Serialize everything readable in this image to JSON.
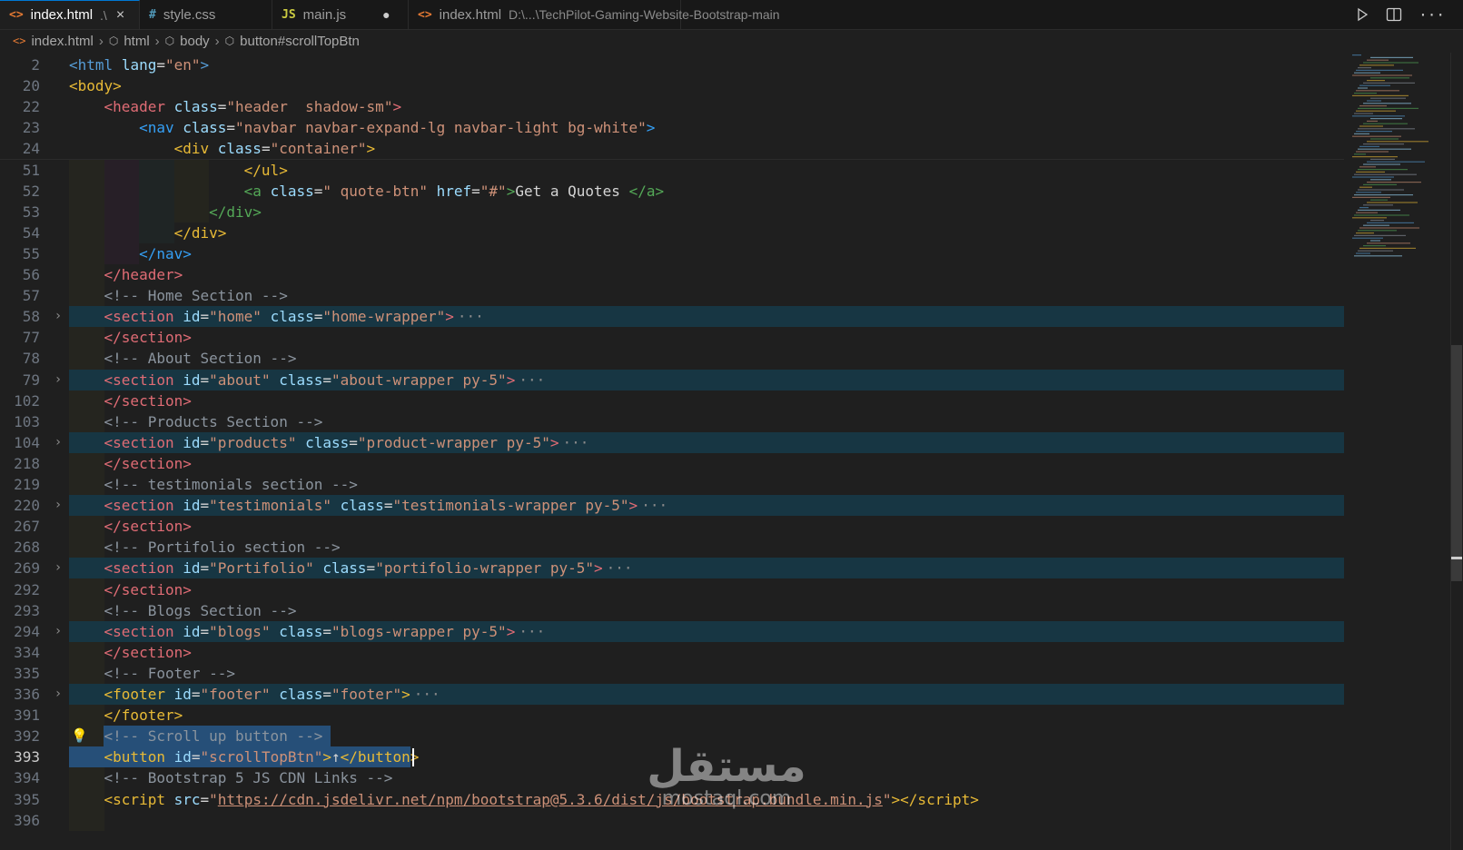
{
  "tabs": [
    {
      "label": "index.html",
      "desc": ".\\",
      "type": "html",
      "active": true,
      "close": "×"
    },
    {
      "label": "style.css",
      "desc": "",
      "type": "css",
      "active": false
    },
    {
      "label": "main.js",
      "desc": "",
      "type": "js",
      "active": false,
      "modified": "●"
    },
    {
      "label": "index.html",
      "desc": "D:\\...\\TechPilot-Gaming-Website-Bootstrap-main",
      "type": "html",
      "active": false
    }
  ],
  "tab_icons": {
    "html": "<>",
    "css": "#",
    "js": "JS"
  },
  "toolbar": {
    "run": "run-icon",
    "split": "split-editor-icon",
    "more": "···"
  },
  "breadcrumbs": [
    "index.html",
    "html",
    "body",
    "button#scrollTopBtn"
  ],
  "lines": [
    {
      "n": "2",
      "html": "<span class='tag'>&lt;html</span> <span class='attr'>lang</span><span class='txt'>=</span><span class='str'>\"en\"</span><span class='tag'>&gt;</span>"
    },
    {
      "n": "20",
      "html": "<span class='t2'>&lt;body&gt;</span>"
    },
    {
      "n": "22",
      "html": "    <span class='t5'>&lt;header</span> <span class='attr'>class</span><span class='txt'>=</span><span class='str'>\"header  shadow-sm\"</span><span class='t5'>&gt;</span>"
    },
    {
      "n": "23",
      "html": "        <span class='t4'>&lt;nav</span> <span class='attr'>class</span><span class='txt'>=</span><span class='str'>\"navbar navbar-expand-lg navbar-light bg-white\"</span><span class='t4'>&gt;</span>"
    },
    {
      "n": "24",
      "html": "            <span class='t2'>&lt;div</span> <span class='attr'>class</span><span class='txt'>=</span><span class='str'>\"container\"</span><span class='t2'>&gt;</span>"
    },
    {
      "n": "51",
      "html": "                    <span class='t2'>&lt;/ul&gt;</span>"
    },
    {
      "n": "52",
      "html": "                    <span class='t3'>&lt;a</span> <span class='attr'>class</span><span class='txt'>=</span><span class='str'>\" quote-btn\"</span> <span class='attr'>href</span><span class='txt'>=</span><span class='str'>\"#\"</span><span class='t3'>&gt;</span><span class='txt'>Get a Quotes </span><span class='t3'>&lt;/a&gt;</span>"
    },
    {
      "n": "53",
      "html": "                <span class='t3'>&lt;/div&gt;</span>"
    },
    {
      "n": "54",
      "html": "            <span class='t2'>&lt;/div&gt;</span>"
    },
    {
      "n": "55",
      "html": "        <span class='t4'>&lt;/nav&gt;</span>"
    },
    {
      "n": "56",
      "html": "    <span class='t5'>&lt;/header&gt;</span>"
    },
    {
      "n": "57",
      "html": "    <span class='comment'>&lt;!-- Home Section --&gt;</span>"
    },
    {
      "n": "58",
      "fold": true,
      "hl": true,
      "html": "    <span class='t5'>&lt;section</span> <span class='attr'>id</span><span class='txt'>=</span><span class='str'>\"home\"</span> <span class='attr'>class</span><span class='txt'>=</span><span class='str'>\"home-wrapper\"</span><span class='t5'>&gt;</span><span class='dots'>···</span>"
    },
    {
      "n": "77",
      "html": "    <span class='t5'>&lt;/section&gt;</span>"
    },
    {
      "n": "78",
      "html": "    <span class='comment'>&lt;!-- About Section --&gt;</span>"
    },
    {
      "n": "79",
      "fold": true,
      "hl": true,
      "html": "    <span class='t5'>&lt;section</span> <span class='attr'>id</span><span class='txt'>=</span><span class='str'>\"about\"</span> <span class='attr'>class</span><span class='txt'>=</span><span class='str'>\"about-wrapper py-5\"</span><span class='t5'>&gt;</span><span class='dots'>···</span>"
    },
    {
      "n": "102",
      "html": "    <span class='t5'>&lt;/section&gt;</span>"
    },
    {
      "n": "103",
      "html": "    <span class='comment'>&lt;!-- Products Section --&gt;</span>"
    },
    {
      "n": "104",
      "fold": true,
      "hl": true,
      "html": "    <span class='t5'>&lt;section</span> <span class='attr'>id</span><span class='txt'>=</span><span class='str'>\"products\"</span> <span class='attr'>class</span><span class='txt'>=</span><span class='str'>\"product-wrapper py-5\"</span><span class='t5'>&gt;</span><span class='dots'>···</span>"
    },
    {
      "n": "218",
      "html": "    <span class='t5'>&lt;/section&gt;</span>"
    },
    {
      "n": "219",
      "html": "    <span class='comment'>&lt;!-- testimonials section --&gt;</span>"
    },
    {
      "n": "220",
      "fold": true,
      "hl": true,
      "html": "    <span class='t5'>&lt;section</span> <span class='attr'>id</span><span class='txt'>=</span><span class='str'>\"testimonials\"</span> <span class='attr'>class</span><span class='txt'>=</span><span class='str'>\"testimonials-wrapper py-5\"</span><span class='t5'>&gt;</span><span class='dots'>···</span>"
    },
    {
      "n": "267",
      "html": "    <span class='t5'>&lt;/section&gt;</span>"
    },
    {
      "n": "268",
      "html": "    <span class='comment'>&lt;!-- Portifolio section --&gt;</span>"
    },
    {
      "n": "269",
      "fold": true,
      "hl": true,
      "html": "    <span class='t5'>&lt;section</span> <span class='attr'>id</span><span class='txt'>=</span><span class='str'>\"Portifolio\"</span> <span class='attr'>class</span><span class='txt'>=</span><span class='str'>\"portifolio-wrapper py-5\"</span><span class='t5'>&gt;</span><span class='dots'>···</span>"
    },
    {
      "n": "292",
      "html": "    <span class='t5'>&lt;/section&gt;</span>"
    },
    {
      "n": "293",
      "html": "    <span class='comment'>&lt;!-- Blogs Section --&gt;</span>"
    },
    {
      "n": "294",
      "fold": true,
      "hl": true,
      "html": "    <span class='t5'>&lt;section</span> <span class='attr'>id</span><span class='txt'>=</span><span class='str'>\"blogs\"</span> <span class='attr'>class</span><span class='txt'>=</span><span class='str'>\"blogs-wrapper py-5\"</span><span class='t5'>&gt;</span><span class='dots'>···</span>"
    },
    {
      "n": "334",
      "html": "    <span class='t5'>&lt;/section&gt;</span>"
    },
    {
      "n": "335",
      "html": "    <span class='comment'>&lt;!-- Footer --&gt;</span>"
    },
    {
      "n": "336",
      "fold": true,
      "hl": true,
      "html": "    <span class='t2'>&lt;footer</span> <span class='attr'>id</span><span class='txt'>=</span><span class='str'>\"footer\"</span> <span class='attr'>class</span><span class='txt'>=</span><span class='str'>\"footer\"</span><span class='t2'>&gt;</span><span class='dots'>···</span>"
    },
    {
      "n": "391",
      "html": "    <span class='t2'>&lt;/footer&gt;</span>"
    },
    {
      "n": "392",
      "bulb": true,
      "html": "    <span class='comment'>&lt;!-- Scroll up button --&gt;</span>"
    },
    {
      "n": "393",
      "current": true,
      "html": "    <span class='t2'>&lt;button</span> <span class='attr'>id</span><span class='txt'>=</span><span class='str'>\"scrollTopBtn\"</span><span class='t2'>&gt;</span><span class='txt'>↑</span><span class='t2'>&lt;/button&gt;</span>"
    },
    {
      "n": "394",
      "html": "    <span class='comment'>&lt;!-- Bootstrap 5 JS CDN Links --&gt;</span>"
    },
    {
      "n": "395",
      "html": "    <span class='t2'>&lt;script</span> <span class='attr'>src</span><span class='txt'>=</span><span class='str'>\"</span><span class='link'>https://cdn.jsdelivr.net/npm/bootstrap@5.3.6/dist/js/bootstrap.bundle.min.js</span><span class='str'>\"</span><span class='t2'>&gt;&lt;/script&gt;</span>"
    },
    {
      "n": "396",
      "html": ""
    }
  ],
  "watermark": {
    "arabic": "مستقل",
    "latin": "mostaql.com"
  }
}
